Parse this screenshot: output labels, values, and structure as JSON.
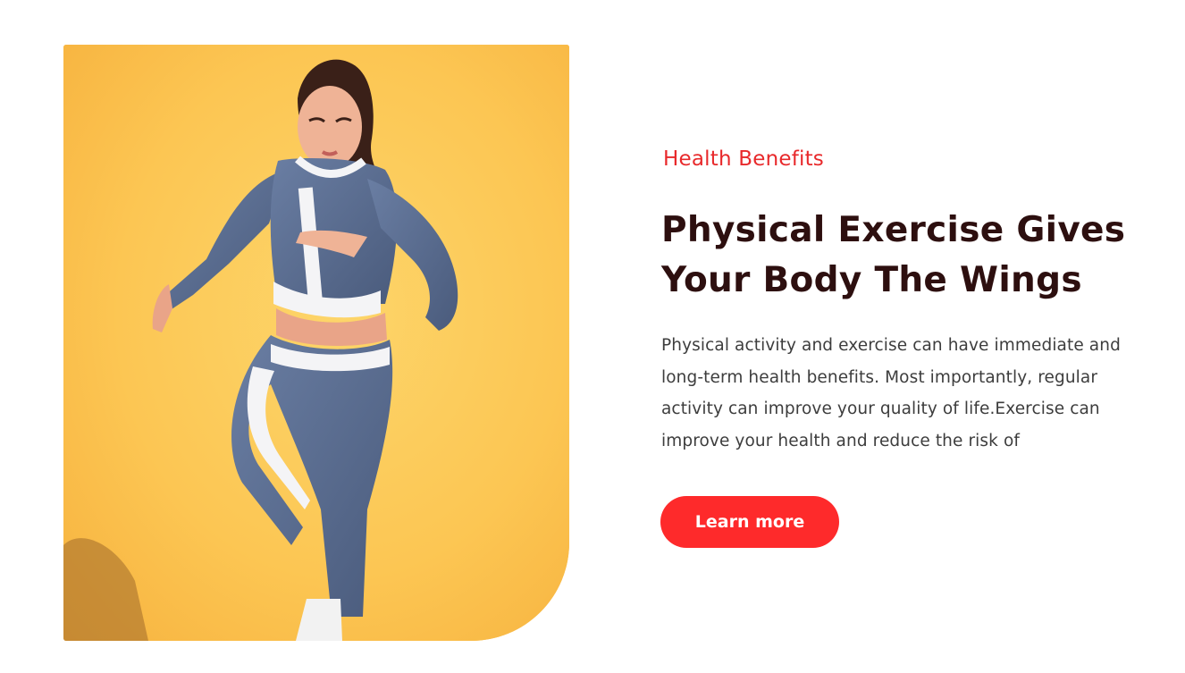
{
  "hero": {
    "image_subject": "athlete-running-photo",
    "background_color": "#fcc653"
  },
  "section": {
    "eyebrow": "Health Benefits",
    "headline": "Physical Exercise Gives Your Body The Wings",
    "body": "Physical activity and exercise can have immediate and long-term health benefits. Most importantly, regular activity can improve your quality of life.Exercise can improve your health and reduce the risk of",
    "cta_label": "Learn more"
  },
  "colors": {
    "accent": "#fe2a2b",
    "eyebrow": "#e8292b",
    "headline": "#2d0f0f",
    "body_text": "#3d3d3d"
  }
}
